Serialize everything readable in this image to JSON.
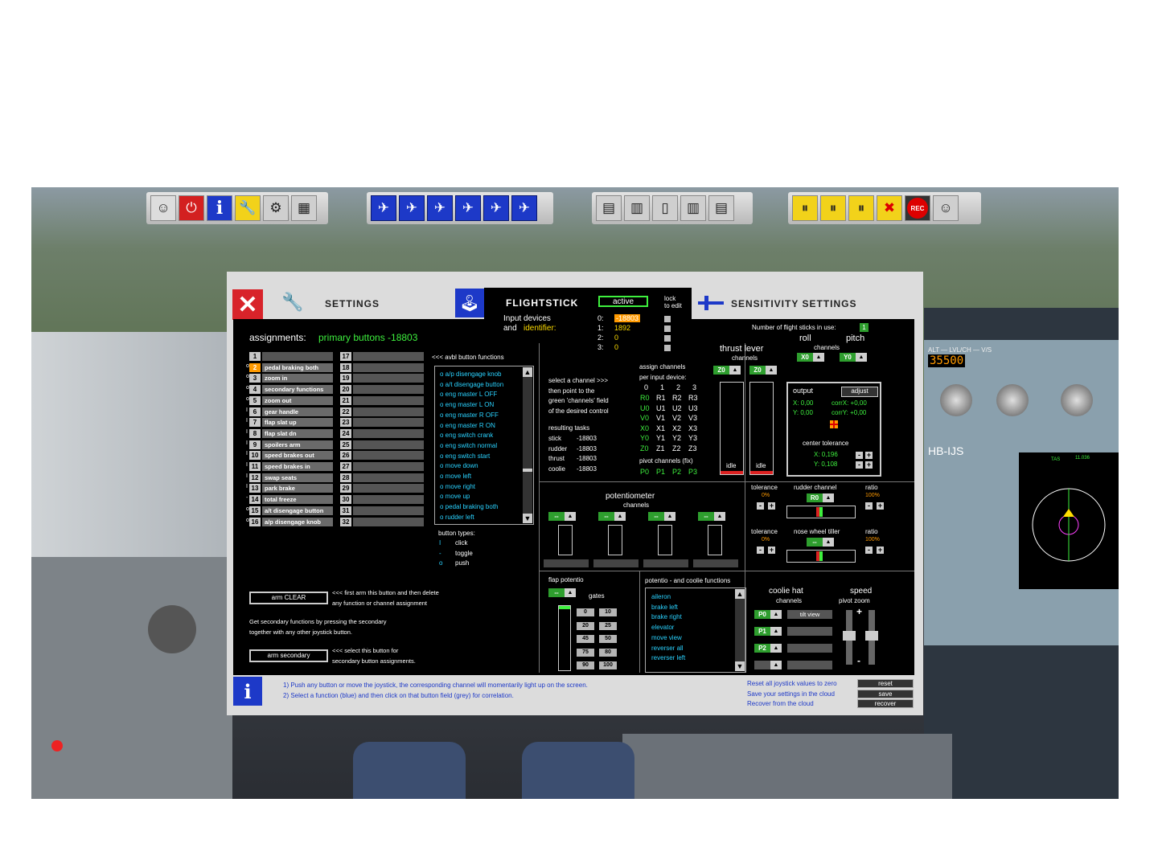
{
  "toolbar": {
    "group1": [
      {
        "icon": "pilots-icon"
      },
      {
        "icon": "power-icon"
      },
      {
        "icon": "info-icon",
        "glyph": "i"
      },
      {
        "icon": "wrench-icon"
      },
      {
        "icon": "gears-icon"
      },
      {
        "icon": "camera-icon"
      }
    ],
    "group2": [
      {
        "icon": "plane-taxi-icon"
      },
      {
        "icon": "plane-takeoff-icon"
      },
      {
        "icon": "plane-climb-icon"
      },
      {
        "icon": "plane-cruise-icon"
      },
      {
        "icon": "plane-descent-icon"
      },
      {
        "icon": "plane-landing-icon"
      }
    ],
    "group3": [
      {
        "icon": "panel-1-icon"
      },
      {
        "icon": "panel-2-icon"
      },
      {
        "icon": "panel-3-icon"
      },
      {
        "icon": "panel-4-icon"
      },
      {
        "icon": "panel-5-icon"
      }
    ],
    "group4": [
      {
        "icon": "pause-pin-icon"
      },
      {
        "icon": "pause-pin-2-icon"
      },
      {
        "icon": "pause-plane-icon"
      },
      {
        "icon": "mute-plane-icon"
      },
      {
        "icon": "record-icon",
        "label": "REC"
      },
      {
        "icon": "pilots-2-icon"
      }
    ]
  },
  "dialog": {
    "settings_title": "SETTINGS",
    "flightstick_title": "FLIGHTSTICK",
    "sensitivity_title": "SENSITIVITY SETTINGS",
    "active_label": "active",
    "lock_label_1": "lock",
    "lock_label_2": "to edit",
    "input_devices_1": "Input devices",
    "input_devices_2a": "and",
    "input_devices_2b": "identifier:",
    "devices": [
      {
        "idx": "0:",
        "id": "-18803"
      },
      {
        "idx": "1:",
        "id": "1892"
      },
      {
        "idx": "2:",
        "id": "0"
      },
      {
        "idx": "3:",
        "id": "0"
      }
    ],
    "sticks_in_use_label": "Number of flight sticks in use:",
    "sticks_in_use": "1",
    "assignments_label": "assignments:",
    "assignments_value": "primary buttons -18803",
    "avbl_header": "<<< avbl button functions",
    "slots_left": [
      {
        "prefix": "",
        "num": "1",
        "label": ""
      },
      {
        "prefix": "o",
        "num": "2",
        "label": "pedal braking both"
      },
      {
        "prefix": "o",
        "num": "3",
        "label": "zoom in"
      },
      {
        "prefix": "o",
        "num": "4",
        "label": "secondary functions"
      },
      {
        "prefix": "o",
        "num": "5",
        "label": "zoom out"
      },
      {
        "prefix": "I",
        "num": "6",
        "label": "gear handle"
      },
      {
        "prefix": "I",
        "num": "7",
        "label": "flap slat up"
      },
      {
        "prefix": "I",
        "num": "8",
        "label": "flap slat dn"
      },
      {
        "prefix": "I",
        "num": "9",
        "label": "spoilers arm"
      },
      {
        "prefix": "I",
        "num": "10",
        "label": "speed brakes out"
      },
      {
        "prefix": "I",
        "num": "11",
        "label": "speed brakes in"
      },
      {
        "prefix": "I",
        "num": "12",
        "label": "swap seats"
      },
      {
        "prefix": "I",
        "num": "13",
        "label": "park brake"
      },
      {
        "prefix": "-",
        "num": "14",
        "label": "total freeze"
      },
      {
        "prefix": "o",
        "num": "15",
        "label": "a/t disengage button"
      },
      {
        "prefix": "o",
        "num": "16",
        "label": "a/p disengage knob"
      }
    ],
    "slots_right": [
      "17",
      "18",
      "19",
      "20",
      "21",
      "22",
      "23",
      "24",
      "25",
      "26",
      "27",
      "28",
      "29",
      "30",
      "31",
      "32"
    ],
    "functions": [
      "o a/p disengage knob",
      "o a/t disengage button",
      "o eng master L OFF",
      "o eng master L ON",
      "o eng master R OFF",
      "o eng master R ON",
      "o eng switch crank",
      "o eng switch normal",
      "o eng switch start",
      "o move down",
      "o move left",
      "o move right",
      "o move up",
      "o pedal braking both",
      "o rudder left"
    ],
    "button_types_label": "button types:",
    "button_types": [
      {
        "sym": "I",
        "name": "click"
      },
      {
        "sym": "-",
        "name": "toggle"
      },
      {
        "sym": "o",
        "name": "push"
      }
    ],
    "arm_clear_label": "arm CLEAR",
    "arm_clear_hint_1": "<<< first arm this button and then delete",
    "arm_clear_hint_2": "any function or channel assignment",
    "secondary_hint_1": "Get secondary functions by pressing the secondary",
    "secondary_hint_2": "together with any other joystick button.",
    "arm_secondary_label": "arm secondary",
    "arm_secondary_hint_1": "<<< select this button for",
    "arm_secondary_hint_2": "secondary button assignments.",
    "select_channel": [
      "select a channel >>>",
      "then point to the",
      "green 'channels' field",
      "of the desired control"
    ],
    "resulting_tasks_label": "resulting tasks",
    "tasks": [
      {
        "name": "stick",
        "val": "-18803"
      },
      {
        "name": "rudder",
        "val": "-18803"
      },
      {
        "name": "thrust",
        "val": "-18803"
      },
      {
        "name": "coolie",
        "val": "-18803"
      }
    ],
    "assign_channels_1": "assign channels",
    "assign_channels_2": "per input device:",
    "channel_cols": [
      "0",
      "1",
      "2",
      "3"
    ],
    "channel_rows": [
      [
        "R0",
        "R1",
        "R2",
        "R3"
      ],
      [
        "U0",
        "U1",
        "U2",
        "U3"
      ],
      [
        "V0",
        "V1",
        "V2",
        "V3"
      ],
      [
        "X0",
        "X1",
        "X2",
        "X3"
      ],
      [
        "Y0",
        "Y1",
        "Y2",
        "Y3"
      ],
      [
        "Z0",
        "Z1",
        "Z2",
        "Z3"
      ]
    ],
    "pivot_label": "pivot channels (fix)",
    "pivot_row": [
      "P0",
      "P1",
      "P2",
      "P3"
    ],
    "thrust_lever_label": "thrust lever",
    "thrust_lever_sub": "channels",
    "thrust_ch_left": "Z0",
    "thrust_ch_right": "Z0",
    "idle_label": "idle",
    "roll_label": "roll",
    "pitch_label": "pitch",
    "roll_pitch_sub": "channels",
    "roll_ch": "X0",
    "pitch_ch": "Y0",
    "output_label": "output",
    "adjust_label": "adjust",
    "out_x": "X: 0,00",
    "out_y": "Y: 0,00",
    "corr_x": "corrX: +0,00",
    "corr_y": "corrY: +0,00",
    "center_tol_label": "center tolerance",
    "center_x": "X: 0,196",
    "center_y": "Y: 0,108",
    "potentiometer_label": "potentiometer",
    "potentiometer_sub": "channels",
    "pot_ch": [
      "--",
      "--",
      "--",
      "--"
    ],
    "tolerance_label": "tolerance",
    "rudder_channel_label": "rudder channel",
    "ratio_label": "ratio",
    "tol_value": "0%",
    "ratio_value": "100%",
    "rudder_ch": "R0",
    "nose_wheel_label": "nose wheel tiller",
    "nose_ch": "--",
    "flap_potentio_label": "flap potentio",
    "flap_ch": "--",
    "gates_label": "gates",
    "gates": [
      [
        "0",
        "10"
      ],
      [
        "20",
        "25"
      ],
      [
        "45",
        "50"
      ],
      [
        "75",
        "80"
      ],
      [
        "90",
        "100"
      ]
    ],
    "pot_coolie_label": "potentio - and coolie functions",
    "pot_functions": [
      "aileron",
      "brake left",
      "brake right",
      "elevator",
      "move view",
      "reverser all",
      "reverser left"
    ],
    "coolie_label": "coolie hat",
    "coolie_sub": "channels",
    "coolie_ch": [
      "P0",
      "P1",
      "P2",
      ""
    ],
    "tilt_view_label": "tilt view",
    "speed_label": "speed",
    "pivot_zoom_label": "pivot  zoom",
    "info_1": "1) Push any button or move the joystick, the corresponding channel will momentarily light up on the screen.",
    "info_2": "2) Select a function (blue) and then click on that button field (grey) for correlation.",
    "reset_text": "Reset all joystick values to zero",
    "save_text": "Save your settings in the cloud",
    "recover_text": "Recover from the cloud",
    "reset_btn": "reset",
    "save_btn": "save",
    "recover_btn": "recover"
  },
  "cockpit": {
    "fcu_alt": "35500",
    "fcu_label": "ALT — LVL/CH — V/S",
    "reg_label": "HB-IJS",
    "nd_tas": "TAS",
    "nd_val": "11.036"
  }
}
